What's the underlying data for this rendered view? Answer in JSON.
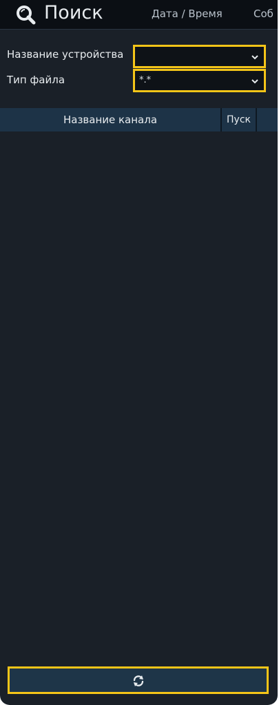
{
  "header": {
    "title": "Поиск",
    "tabs": [
      "Дата / Время",
      "Соб"
    ]
  },
  "filters": {
    "device_name_label": "Название устройства",
    "device_name_value": "",
    "file_type_label": "Тип файла",
    "file_type_value": "*.*"
  },
  "table": {
    "columns": [
      "Название канала",
      "Пуск"
    ],
    "rows": []
  },
  "icons": {
    "search": "search-icon",
    "chevron": "chevron-down-icon",
    "refresh": "refresh-icon"
  },
  "colors": {
    "highlight": "#f5c518",
    "background": "#1a2028",
    "header_bg": "#0b0f14",
    "table_header_bg": "#1d3347"
  }
}
